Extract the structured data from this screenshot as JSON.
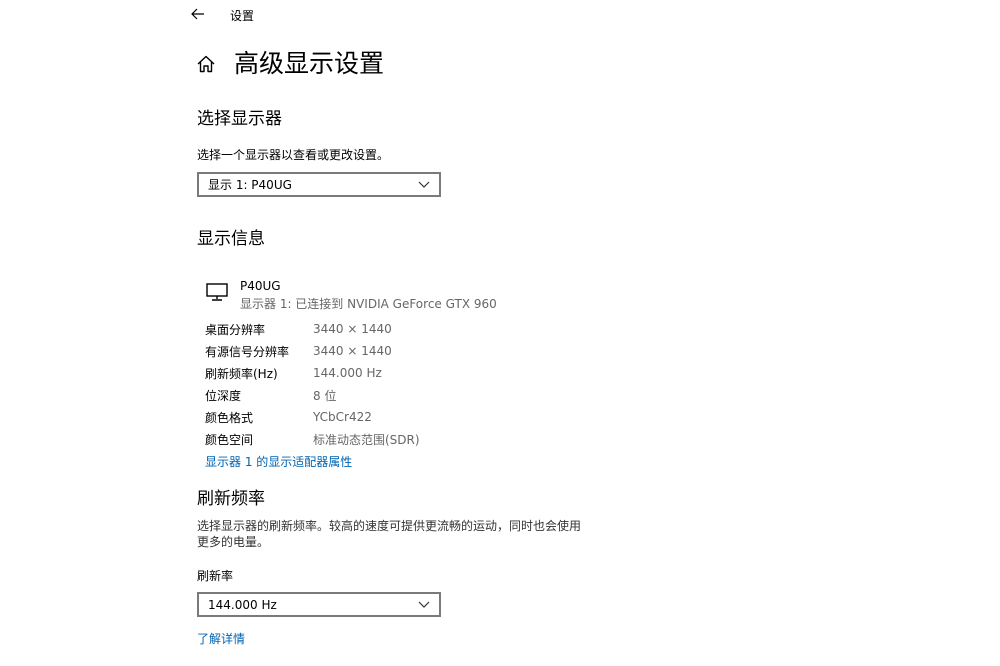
{
  "titlebar": {
    "label": "设置"
  },
  "page": {
    "title": "高级显示设置"
  },
  "select_display": {
    "title": "选择显示器",
    "description": "选择一个显示器以查看或更改设置。",
    "selected": "显示 1: P40UG"
  },
  "display_info": {
    "title": "显示信息",
    "monitor_name": "P40UG",
    "monitor_sub": "显示器 1: 已连接到 NVIDIA GeForce GTX 960",
    "rows": [
      {
        "label": "桌面分辨率",
        "value": "3440 × 1440"
      },
      {
        "label": "有源信号分辨率",
        "value": "3440 × 1440"
      },
      {
        "label": "刷新频率(Hz)",
        "value": "144.000 Hz"
      },
      {
        "label": "位深度",
        "value": "8 位"
      },
      {
        "label": "颜色格式",
        "value": "YCbCr422"
      },
      {
        "label": "颜色空间",
        "value": "标准动态范围(SDR)"
      }
    ],
    "adapter_link": "显示器 1 的显示适配器属性"
  },
  "refresh": {
    "title": "刷新频率",
    "description_line1": "选择显示器的刷新频率。较高的速度可提供更流畅的运动，同时也会使用",
    "description_line2": "更多的电量。",
    "field_label": "刷新率",
    "selected": "144.000 Hz",
    "learn_more": "了解详情"
  },
  "colors": {
    "link": "#0063b1",
    "select_border": "#7a7a7a"
  }
}
